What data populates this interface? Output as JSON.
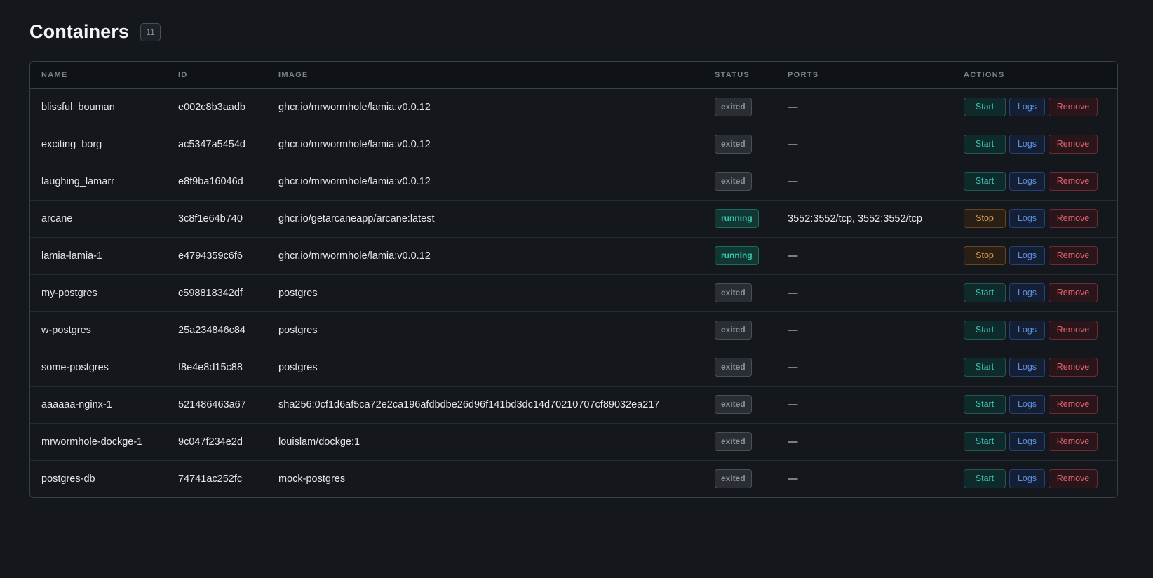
{
  "header": {
    "title": "Containers",
    "count": "11"
  },
  "columns": [
    "NAME",
    "ID",
    "IMAGE",
    "STATUS",
    "PORTS",
    "ACTIONS"
  ],
  "labels": {
    "start": "Start",
    "stop": "Stop",
    "logs": "Logs",
    "remove": "Remove"
  },
  "colors": {
    "background": "#14171c",
    "running": "#34c7b0",
    "exited": "#8a9099",
    "start": "#3ac2b2",
    "stop": "#e0a050",
    "logs": "#5c8fe0",
    "remove": "#e2636f"
  },
  "rows": [
    {
      "name": "blissful_bouman",
      "id": "e002c8b3aadb",
      "image": "ghcr.io/mrwormhole/lamia:v0.0.12",
      "status": "exited",
      "ports": "—",
      "primary_action": "Start"
    },
    {
      "name": "exciting_borg",
      "id": "ac5347a5454d",
      "image": "ghcr.io/mrwormhole/lamia:v0.0.12",
      "status": "exited",
      "ports": "—",
      "primary_action": "Start"
    },
    {
      "name": "laughing_lamarr",
      "id": "e8f9ba16046d",
      "image": "ghcr.io/mrwormhole/lamia:v0.0.12",
      "status": "exited",
      "ports": "—",
      "primary_action": "Start"
    },
    {
      "name": "arcane",
      "id": "3c8f1e64b740",
      "image": "ghcr.io/getarcaneapp/arcane:latest",
      "status": "running",
      "ports": "3552:3552/tcp, 3552:3552/tcp",
      "primary_action": "Stop"
    },
    {
      "name": "lamia-lamia-1",
      "id": "e4794359c6f6",
      "image": "ghcr.io/mrwormhole/lamia:v0.0.12",
      "status": "running",
      "ports": "—",
      "primary_action": "Stop"
    },
    {
      "name": "my-postgres",
      "id": "c598818342df",
      "image": "postgres",
      "status": "exited",
      "ports": "—",
      "primary_action": "Start"
    },
    {
      "name": "w-postgres",
      "id": "25a234846c84",
      "image": "postgres",
      "status": "exited",
      "ports": "—",
      "primary_action": "Start"
    },
    {
      "name": "some-postgres",
      "id": "f8e4e8d15c88",
      "image": "postgres",
      "status": "exited",
      "ports": "—",
      "primary_action": "Start"
    },
    {
      "name": "aaaaaa-nginx-1",
      "id": "521486463a67",
      "image": "sha256:0cf1d6af5ca72e2ca196afdbdbe26d96f141bd3dc14d70210707cf89032ea217",
      "status": "exited",
      "ports": "—",
      "primary_action": "Start"
    },
    {
      "name": "mrwormhole-dockge-1",
      "id": "9c047f234e2d",
      "image": "louislam/dockge:1",
      "status": "exited",
      "ports": "—",
      "primary_action": "Start"
    },
    {
      "name": "postgres-db",
      "id": "74741ac252fc",
      "image": "mock-postgres",
      "status": "exited",
      "ports": "—",
      "primary_action": "Start"
    }
  ]
}
